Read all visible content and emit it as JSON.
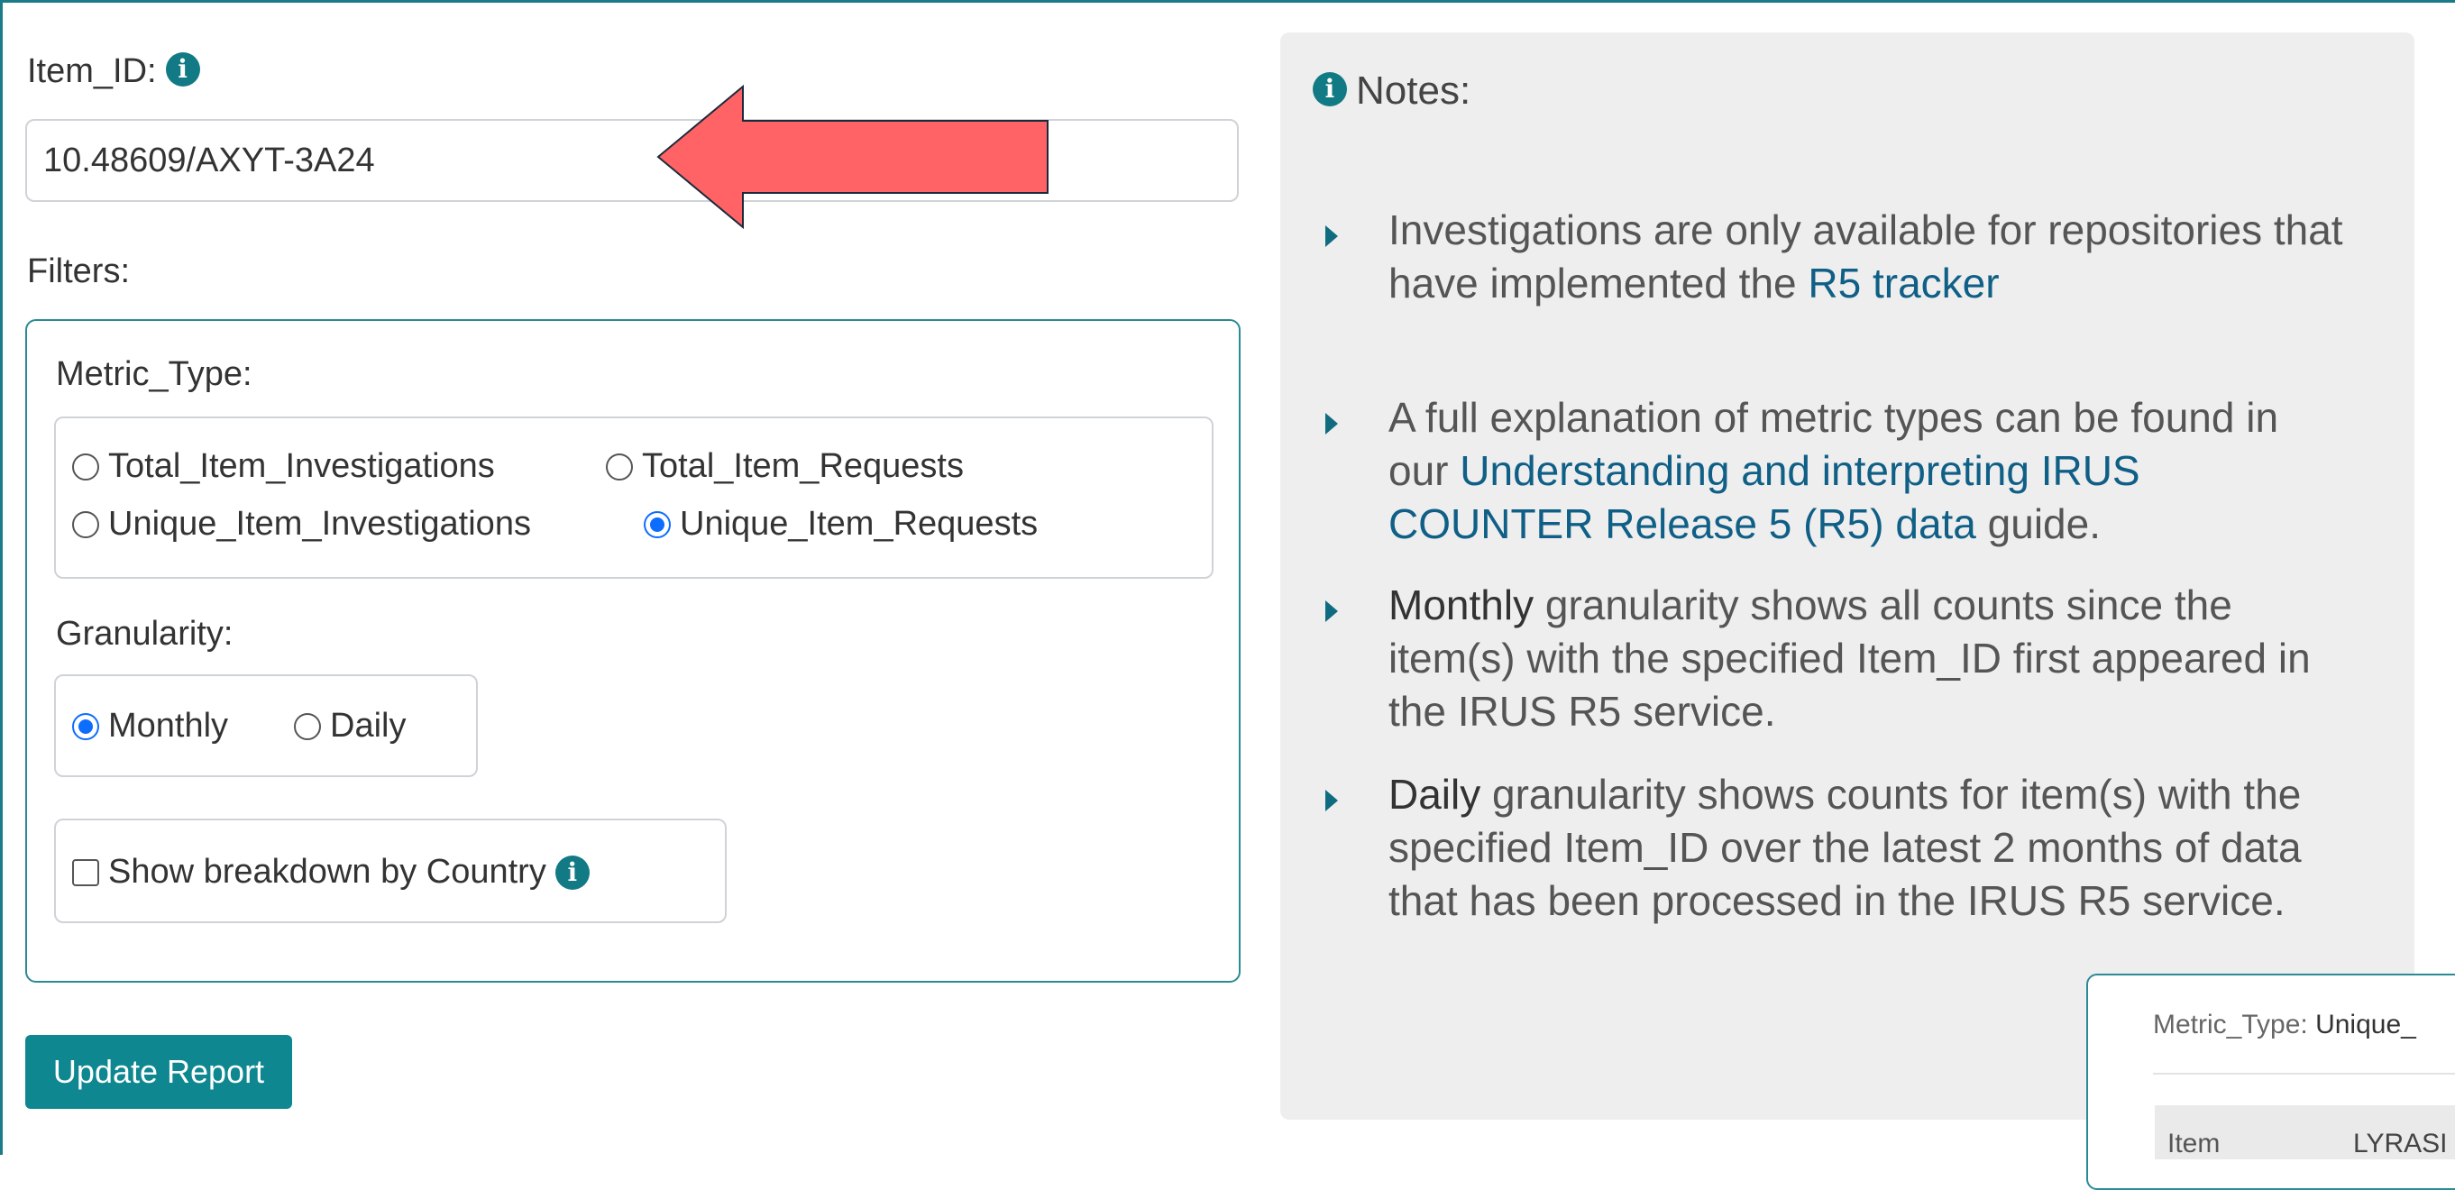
{
  "form": {
    "item_id_label": "Item_ID:",
    "item_id_value": "10.48609/AXYT-3A24",
    "filters_label": "Filters:",
    "metric_type_label": "Metric_Type:",
    "metric_options": [
      {
        "label": "Total_Item_Investigations",
        "checked": false
      },
      {
        "label": "Total_Item_Requests",
        "checked": false
      },
      {
        "label": "Unique_Item_Investigations",
        "checked": false
      },
      {
        "label": "Unique_Item_Requests",
        "checked": true
      }
    ],
    "granularity_label": "Granularity:",
    "granularity_options": [
      {
        "label": "Monthly",
        "checked": true
      },
      {
        "label": "Daily",
        "checked": false
      }
    ],
    "country_breakdown_label": "Show breakdown by Country",
    "country_breakdown_checked": false,
    "update_button": "Update Report"
  },
  "annotation": {
    "arrow_color": "#ff6366",
    "arrow_icon": "left-arrow-icon"
  },
  "notes": {
    "title": "Notes:",
    "items": [
      {
        "pre": "Investigations are only available for repositories that have implemented the ",
        "link": "R5 tracker",
        "post": ""
      },
      {
        "pre": "A full explanation of metric types can be found in our ",
        "link": "Understanding and interpreting IRUS COUNTER Release 5 (R5) data",
        "post": " guide."
      },
      {
        "strong": "Monthly",
        "post": " granularity shows all counts since the item(s) with the specified Item_ID first appeared in the IRUS R5 service."
      },
      {
        "strong": "Daily",
        "post": " granularity shows counts for item(s) with the specified Item_ID over the latest 2 months of data that has been processed in the IRUS R5 service."
      }
    ]
  },
  "overlay": {
    "metric_label": "Metric_Type: ",
    "metric_value": "Unique_",
    "col1": "Item",
    "col2": "LYRASI"
  },
  "colors": {
    "accent": "#0f8791",
    "radio_checked": "#0d6efd",
    "notes_bg": "#eeeeee",
    "link": "#0f5f86"
  }
}
